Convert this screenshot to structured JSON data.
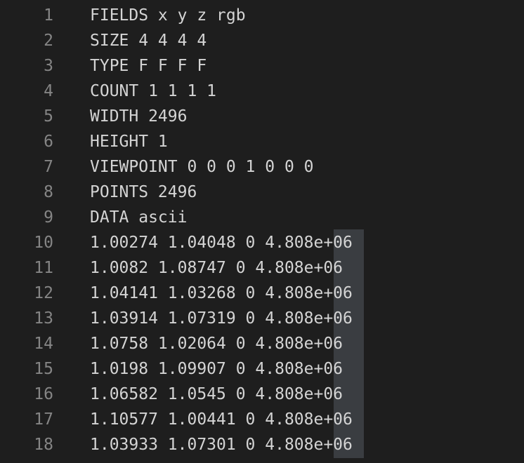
{
  "editor": {
    "lines": [
      {
        "number": "1",
        "text": "FIELDS x y z rgb"
      },
      {
        "number": "2",
        "text": "SIZE 4 4 4 4"
      },
      {
        "number": "3",
        "text": "TYPE F F F F"
      },
      {
        "number": "4",
        "text": "COUNT 1 1 1 1"
      },
      {
        "number": "5",
        "text": "WIDTH 2496"
      },
      {
        "number": "6",
        "text": "HEIGHT 1"
      },
      {
        "number": "7",
        "text": "VIEWPOINT 0 0 0 1 0 0 0"
      },
      {
        "number": "8",
        "text": "POINTS 2496"
      },
      {
        "number": "9",
        "text": "DATA ascii"
      },
      {
        "number": "10",
        "text": "1.00274 1.04048 0 4.808e+06"
      },
      {
        "number": "11",
        "text": "1.0082 1.08747 0 4.808e+06"
      },
      {
        "number": "12",
        "text": "1.04141 1.03268 0 4.808e+06"
      },
      {
        "number": "13",
        "text": "1.03914 1.07319 0 4.808e+06"
      },
      {
        "number": "14",
        "text": "1.0758 1.02064 0 4.808e+06"
      },
      {
        "number": "15",
        "text": "1.0198 1.09907 0 4.808e+06"
      },
      {
        "number": "16",
        "text": "1.06582 1.0545 0 4.808e+06"
      },
      {
        "number": "17",
        "text": "1.10577 1.00441 0 4.808e+06"
      },
      {
        "number": "18",
        "text": "1.03933 1.07301 0 4.808e+06"
      }
    ]
  },
  "colors": {
    "background": "#1e1e1e",
    "text": "#d4d4d4",
    "line_number": "#858585",
    "column_selection": "#3a3d41"
  }
}
